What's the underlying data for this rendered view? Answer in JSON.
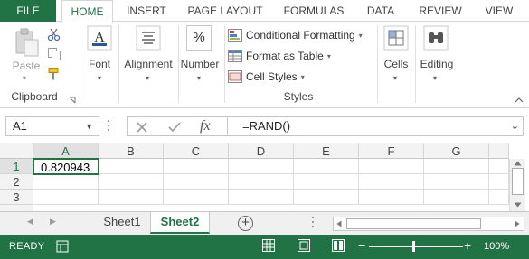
{
  "ribbon_tabs": {
    "file": "FILE",
    "home": "HOME",
    "insert": "INSERT",
    "page_layout": "PAGE LAYOUT",
    "formulas": "FORMULAS",
    "data": "DATA",
    "review": "REVIEW",
    "view": "VIEW"
  },
  "clipboard": {
    "paste": "Paste",
    "group_label": "Clipboard"
  },
  "font": {
    "label": "Font"
  },
  "alignment": {
    "label": "Alignment"
  },
  "number": {
    "label": "Number",
    "icon_glyph": "%"
  },
  "styles": {
    "conditional_formatting": "Conditional Formatting",
    "format_as_table": "Format as Table",
    "cell_styles": "Cell Styles",
    "group_label": "Styles"
  },
  "cells": {
    "label": "Cells"
  },
  "editing": {
    "label": "Editing"
  },
  "formula_bar": {
    "name_box": "A1",
    "fx_glyph": "fx",
    "formula": "=RAND()"
  },
  "grid": {
    "columns": [
      "A",
      "B",
      "C",
      "D",
      "E",
      "F",
      "G"
    ],
    "rows": [
      "1",
      "2",
      "3"
    ],
    "cells": {
      "A1": "0.820943"
    }
  },
  "sheets": {
    "tabs": [
      "Sheet1",
      "Sheet2"
    ],
    "active": "Sheet2"
  },
  "status_bar": {
    "ready": "READY",
    "zoom": "100%",
    "zoom_level_percent": 100
  },
  "colors": {
    "accent": "#217346",
    "selected_border": "#217346"
  }
}
